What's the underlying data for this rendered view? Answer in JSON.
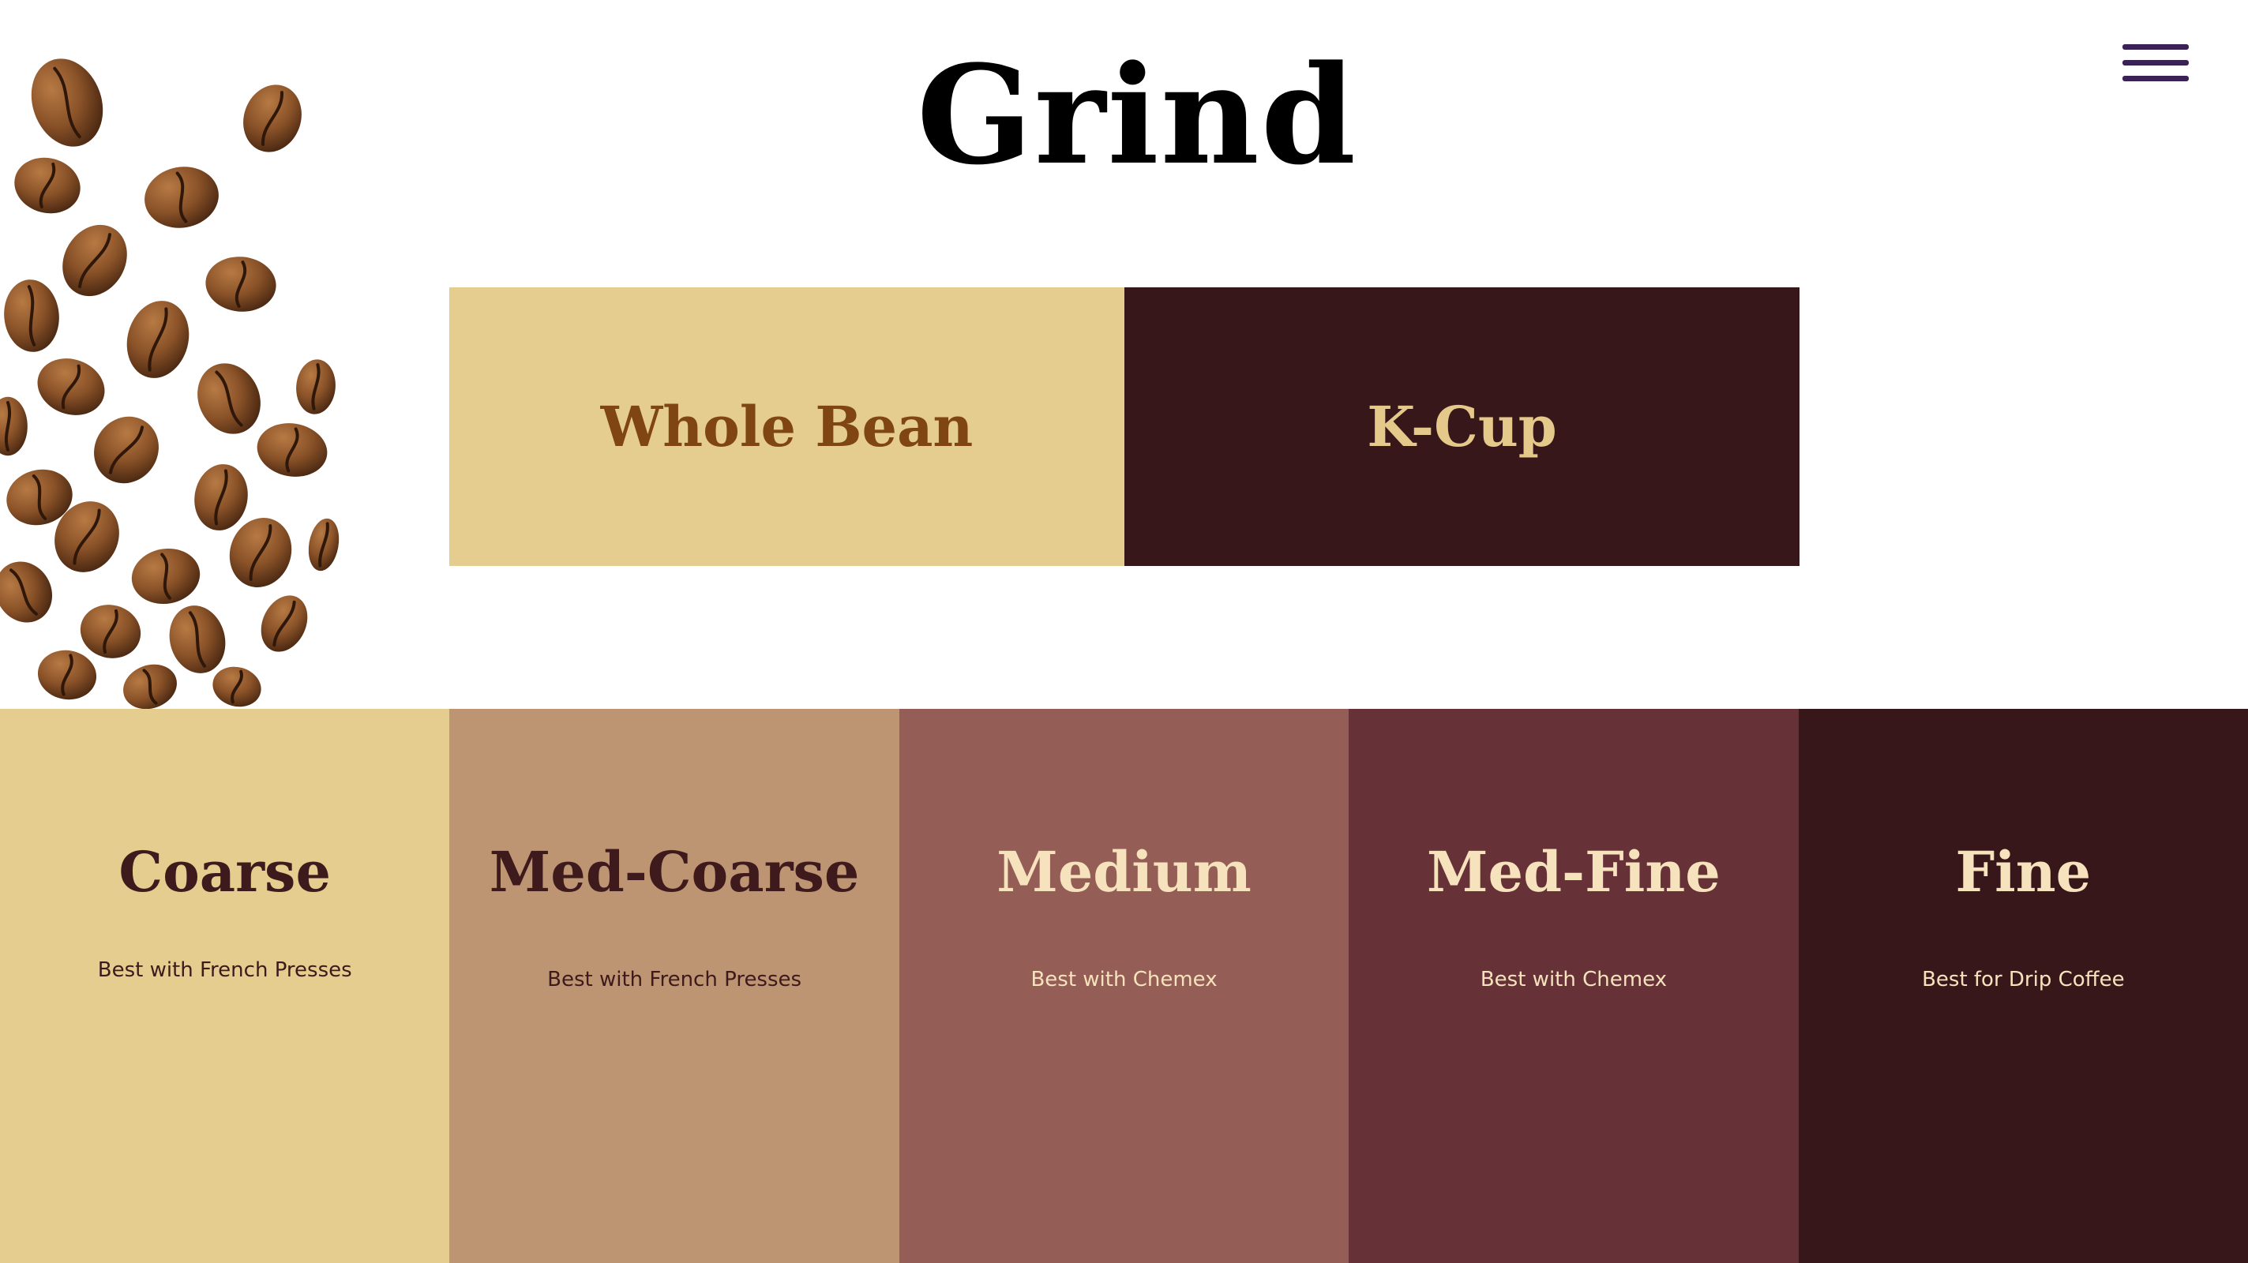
{
  "page": {
    "title": "Grind"
  },
  "colors": {
    "menu": "#3a2256",
    "whole_bean_bg": "#e5cd8f",
    "whole_bean_text": "#7f4513",
    "kcup_bg": "#38171a",
    "kcup_text": "#e5c98b"
  },
  "format_options": [
    {
      "label": "Whole Bean"
    },
    {
      "label": "K-Cup"
    }
  ],
  "grinds": [
    {
      "name": "Coarse",
      "desc": "Best with French Presses",
      "bg": "#e5cd8f",
      "color": "#3e1a1d",
      "desc_color": "#3e1a1d"
    },
    {
      "name": "Med-Coarse",
      "desc": "Best with French Presses",
      "bg": "#be9572",
      "color": "#3e1a1d",
      "desc_color": "#3e1a1d"
    },
    {
      "name": "Medium",
      "desc": "Best with Chemex",
      "bg": "#945d55",
      "color": "#f6e2bd",
      "desc_color": "#f6e2bd"
    },
    {
      "name": "Med-Fine",
      "desc": "Best with Chemex",
      "bg": "#663238",
      "color": "#f6e2bd",
      "desc_color": "#f6e2bd"
    },
    {
      "name": "Fine",
      "desc": "Best for Drip Coffee",
      "bg": "#38171a",
      "color": "#f6e2bd",
      "desc_color": "#f6e2bd"
    }
  ],
  "icons": {
    "menu": "hamburger-menu-icon",
    "image": "coffee-beans-image"
  }
}
